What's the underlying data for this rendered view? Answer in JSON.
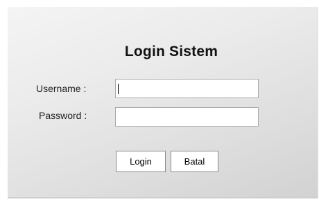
{
  "form": {
    "title": "Login Sistem",
    "username_label": "Username :",
    "password_label": "Password :",
    "username_value": "",
    "password_value": "",
    "login_button": "Login",
    "cancel_button": "Batal"
  }
}
